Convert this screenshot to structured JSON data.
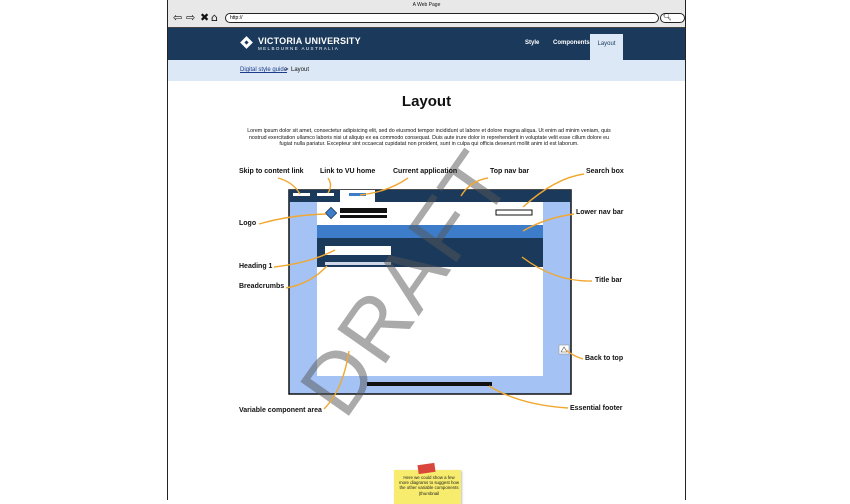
{
  "window": {
    "title": "A Web Page"
  },
  "address": {
    "url": "http://"
  },
  "toolbar": {
    "back_icon": "back-arrow-icon",
    "forward_icon": "forward-arrow-icon",
    "stop_icon": "close-icon",
    "home_icon": "home-icon",
    "search_icon": "search-icon"
  },
  "site": {
    "logo_name": "VICTORIA UNIVERSITY",
    "logo_sub": "MELBOURNE AUSTRALIA",
    "nav": [
      "Style",
      "Components",
      "Layout"
    ],
    "header_color": "#1b3a5b",
    "tab_color": "#dce8f5"
  },
  "breadcrumb": {
    "link": "Digital style guide",
    "separator": ">",
    "current": "Layout"
  },
  "page": {
    "title": "Layout",
    "intro": "Lorem ipsum dolor sit amet, consectetur adipisicing elit, sed do eiusmod tempor incididunt ut labore et dolore magna aliqua. Ut enim ad minim veniam, quis nostrud exercitation ullamco laboris nisi ut aliquip ex ea commodo consequat. Duis aute irure dolor in reprehenderit in voluptate velit esse cillum dolore eu fugiat nulla pariatur. Excepteur sint occaecat cupidatat non proident, sunt in culpa qui officia deserunt mollit anim id est laborum."
  },
  "diagram": {
    "watermark": "DRAFT",
    "labels": {
      "skip": "Skip to content link",
      "vuhome": "Link to VU home",
      "currentapp": "Current application",
      "topnav": "Top nav bar",
      "searchbox": "Search box",
      "lowernav": "Lower nav bar",
      "logo": "Logo",
      "heading1": "Heading 1",
      "breadcrumbs": "Breadcrumbs",
      "titlebar": "Title bar",
      "backtotop": "Back to top",
      "variable": "Variable component area",
      "footer": "Essential footer"
    },
    "callout_color": "#f0a830",
    "frame_color": "#a4c2f4",
    "navy": "#1b3a5b",
    "mid_blue": "#3d7cc9"
  },
  "sticky": {
    "text": "Here we could show a few more diagrams to suggest how the other variable components (thumbnail"
  }
}
